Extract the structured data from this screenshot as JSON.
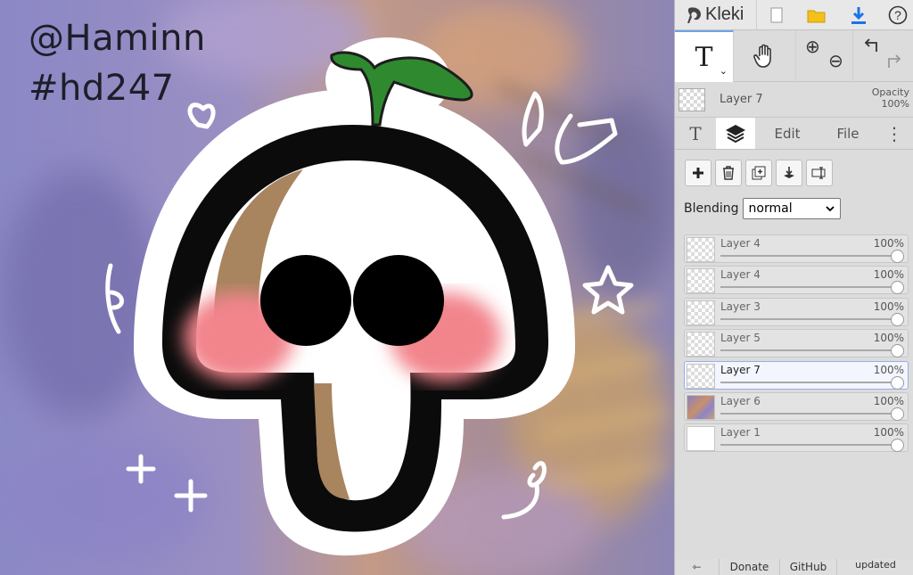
{
  "canvas": {
    "watermark_line1": "@Haminn",
    "watermark_line2": "#hd247"
  },
  "app": {
    "name": "Kleki"
  },
  "toolbar": {
    "icons": [
      "new-image-icon",
      "open-folder-icon",
      "download-icon",
      "help-icon"
    ]
  },
  "tools": {
    "active_tool": "T",
    "zoom_in": "⊕",
    "zoom_out": "⊖"
  },
  "current_layer": {
    "name": "Layer 7",
    "opacity_label": "Opacity",
    "opacity_value": "100%"
  },
  "tabs": {
    "text_tool": "T",
    "edit": "Edit",
    "file": "File"
  },
  "blending": {
    "label": "Blending",
    "selected": "normal"
  },
  "layers": [
    {
      "name": "Layer 4",
      "opacity": "100%"
    },
    {
      "name": "Layer 4",
      "opacity": "100%"
    },
    {
      "name": "Layer 3",
      "opacity": "100%"
    },
    {
      "name": "Layer 5",
      "opacity": "100%"
    },
    {
      "name": "Layer 7",
      "opacity": "100%"
    },
    {
      "name": "Layer 6",
      "opacity": "100%"
    },
    {
      "name": "Layer 1",
      "opacity": "100%"
    }
  ],
  "footer": {
    "back": "⇽",
    "donate": "Donate",
    "github": "GitHub",
    "updated": "updated"
  },
  "colors": {
    "accent_blue": "#1a73e8",
    "folder_yellow": "#f4c11a",
    "sprout_green": "#2f8a2f",
    "blush_pink": "#f2848c"
  }
}
